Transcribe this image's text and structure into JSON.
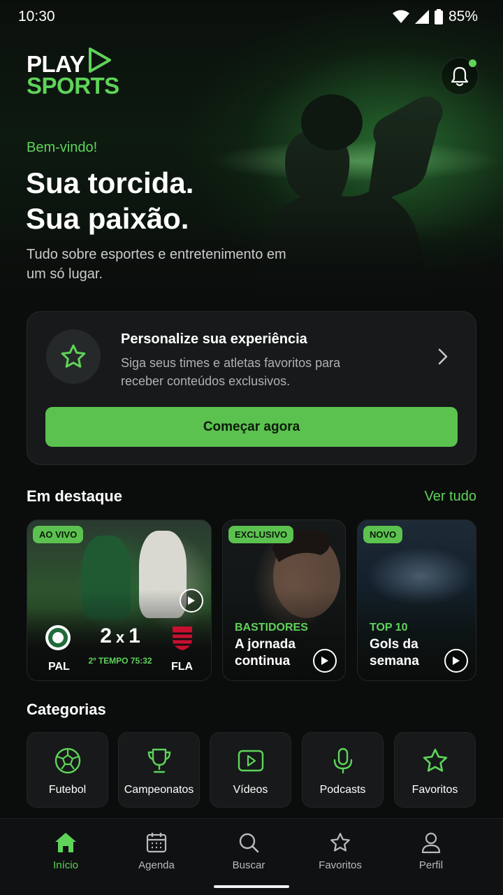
{
  "status_bar": {
    "time": "10:30",
    "battery": "85%"
  },
  "header": {
    "logo_line1": "PLAY",
    "logo_line2": "SPORTS",
    "welcome": "Bem-vindo!",
    "headline_line1": "Sua torcida.",
    "headline_line2": "Sua paixão.",
    "subtitle": "Tudo sobre esportes e entretenimento em um só lugar."
  },
  "personalize": {
    "title": "Personalize sua experiência",
    "description": "Siga seus times e atletas favoritos para receber conteúdos exclusivos.",
    "cta": "Começar agora"
  },
  "featured": {
    "title": "Em destaque",
    "see_all": "Ver tudo",
    "live": {
      "badge": "AO VIVO",
      "home_team": "PAL",
      "away_team": "FLA",
      "home_score": "2",
      "separator": "x",
      "away_score": "1",
      "match_time": "2º TEMPO 75:32"
    },
    "exclusive": {
      "badge": "EXCLUSIVO",
      "kicker": "BASTIDORES",
      "title": "A jornada continua"
    },
    "new": {
      "badge": "NOVO",
      "kicker": "TOP 10",
      "title": "Gols da semana"
    }
  },
  "categories": {
    "title": "Categorias",
    "items": [
      {
        "label": "Futebol",
        "icon": "soccer-ball-icon"
      },
      {
        "label": "Campeonatos",
        "icon": "trophy-icon"
      },
      {
        "label": "Vídeos",
        "icon": "video-icon"
      },
      {
        "label": "Podcasts",
        "icon": "microphone-icon"
      },
      {
        "label": "Favoritos",
        "icon": "star-icon"
      }
    ]
  },
  "bottom_nav": {
    "items": [
      {
        "label": "Início",
        "icon": "home-icon",
        "active": true
      },
      {
        "label": "Agenda",
        "icon": "calendar-icon",
        "active": false
      },
      {
        "label": "Buscar",
        "icon": "search-icon",
        "active": false
      },
      {
        "label": "Favoritos",
        "icon": "star-icon",
        "active": false
      },
      {
        "label": "Perfil",
        "icon": "user-icon",
        "active": false
      }
    ]
  },
  "colors": {
    "accent": "#5fd35a",
    "button": "#5cc24f",
    "background": "#0b0d0c",
    "card": "#17191a"
  }
}
